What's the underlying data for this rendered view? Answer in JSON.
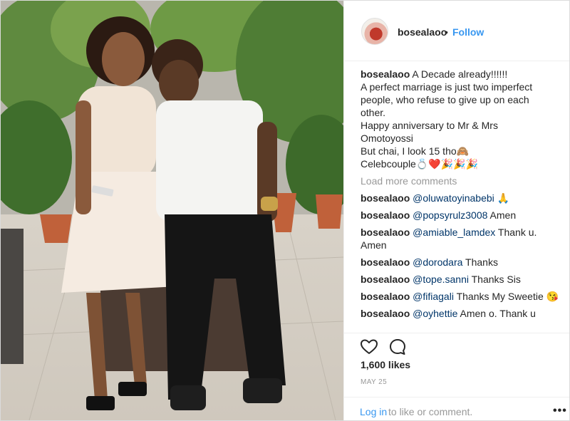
{
  "header": {
    "username": "bosealaoo",
    "separator": "•",
    "follow_label": "Follow"
  },
  "caption": {
    "username": "bosealaoo",
    "lines": [
      "A Decade already!!!!!!",
      "A perfect marriage is just two imperfect",
      "people, who refuse to give up on each",
      "other.",
      "Happy anniversary to Mr & Mrs",
      "Omotoyossi",
      "But chai, I look 15 tho🙈",
      "Celebcouple💍❤️🎉🎉🎉"
    ]
  },
  "load_more": "Load more comments",
  "comments": [
    {
      "user": "bosealaoo",
      "mention": "@oluwatoyinabebi",
      "text": " 🙏"
    },
    {
      "user": "bosealaoo",
      "mention": "@popsyrulz3008",
      "text": " Amen"
    },
    {
      "user": "bosealaoo",
      "mention": "@amiable_lamdex",
      "text": " Thank u. Amen"
    },
    {
      "user": "bosealaoo",
      "mention": "@dorodara",
      "text": " Thanks"
    },
    {
      "user": "bosealaoo",
      "mention": "@tope.sanni",
      "text": " Thanks Sis"
    },
    {
      "user": "bosealaoo",
      "mention": "@fifiagali",
      "text": " Thanks My Sweetie 😘"
    },
    {
      "user": "bosealaoo",
      "mention": "@oyhettie",
      "text": " Amen o. Thank u"
    }
  ],
  "likes": "1,600 likes",
  "date": "MAY 25",
  "footer": {
    "login_label": "Log in",
    "login_rest": "to like or comment.",
    "more_label": "•••"
  },
  "colors": {
    "link": "#3897f0",
    "mention": "#003569",
    "muted": "#999999",
    "border": "#efefef"
  },
  "icons": [
    "heart-icon",
    "comment-icon",
    "more-options-icon"
  ]
}
